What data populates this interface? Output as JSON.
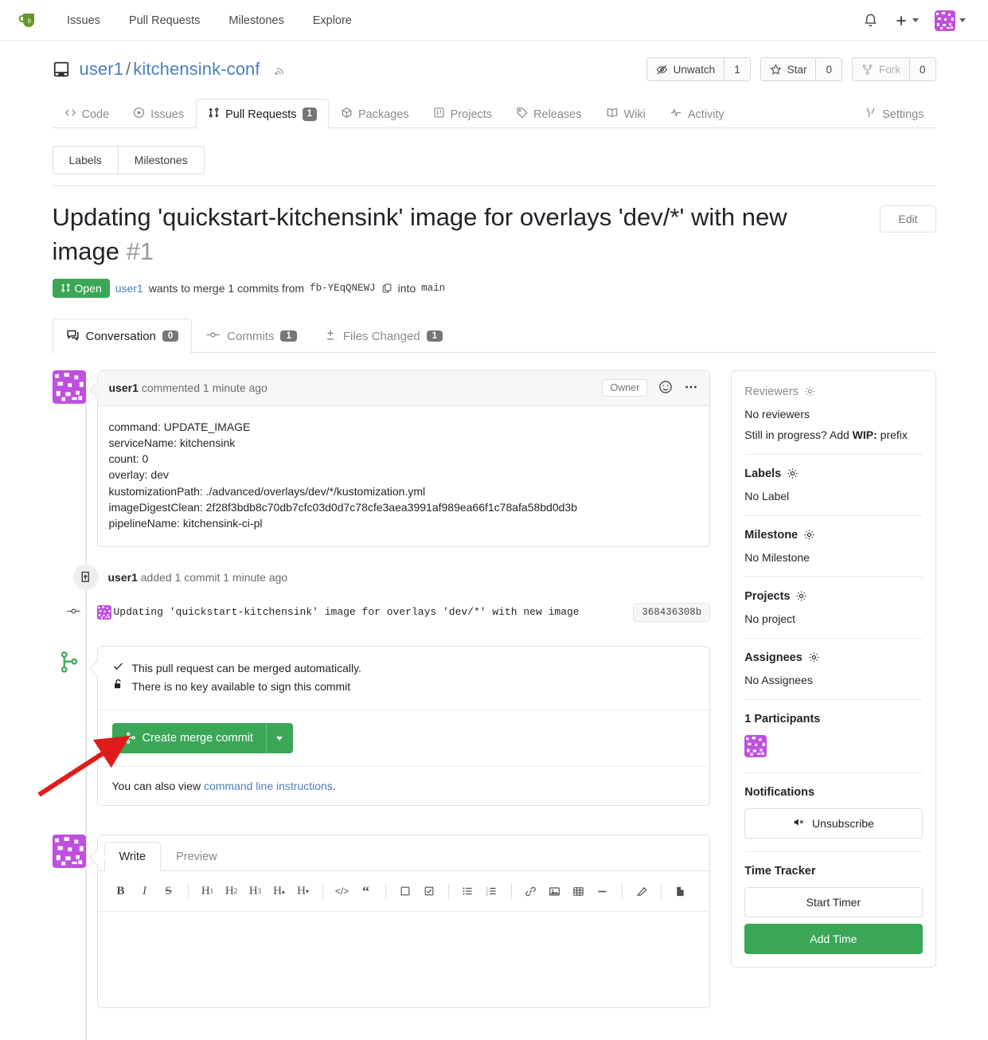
{
  "navbar": {
    "logo_icon": "gitea-logo-icon",
    "links": [
      "Issues",
      "Pull Requests",
      "Milestones",
      "Explore"
    ],
    "bell_icon": "bell-icon",
    "plus_icon": "plus-icon",
    "avatar_icon": "user-avatar"
  },
  "repo": {
    "icon": "repo-icon",
    "owner": "user1",
    "separator": "/",
    "name": "kitchensink-conf",
    "rss_icon": "rss-icon",
    "actions": [
      {
        "label": "Unwatch",
        "count": "1",
        "icon": "eye-slash-icon",
        "disabled": false
      },
      {
        "label": "Star",
        "count": "0",
        "icon": "star-icon",
        "disabled": false
      },
      {
        "label": "Fork",
        "count": "0",
        "icon": "fork-icon",
        "disabled": true
      }
    ],
    "tabs": [
      {
        "label": "Code",
        "icon": "code-icon",
        "count": null,
        "active": false
      },
      {
        "label": "Issues",
        "icon": "issue-opened-icon",
        "count": null,
        "active": false
      },
      {
        "label": "Pull Requests",
        "icon": "git-pull-request-icon",
        "count": "1",
        "active": true
      },
      {
        "label": "Packages",
        "icon": "package-icon",
        "count": null,
        "active": false
      },
      {
        "label": "Projects",
        "icon": "project-icon",
        "count": null,
        "active": false
      },
      {
        "label": "Releases",
        "icon": "tag-icon",
        "count": null,
        "active": false
      },
      {
        "label": "Wiki",
        "icon": "book-icon",
        "count": null,
        "active": false
      },
      {
        "label": "Activity",
        "icon": "pulse-icon",
        "count": null,
        "active": false
      }
    ],
    "settings_tab": {
      "label": "Settings",
      "icon": "tools-icon"
    }
  },
  "filters": {
    "labels": "Labels",
    "milestones": "Milestones"
  },
  "issue": {
    "title": "Updating 'quickstart-kitchensink' image for overlays 'dev/*' with new image",
    "number": "#1",
    "edit_label": "Edit",
    "status": "Open",
    "status_color": "#3aa757",
    "author": "user1",
    "meta_prefix": "wants to merge 1 commits from",
    "source_branch": "fb-YEqQNEWJ",
    "meta_into": "into",
    "target_branch": "main",
    "copy_icon": "copy-icon"
  },
  "pr_tabs": [
    {
      "label": "Conversation",
      "icon": "comment-icon",
      "count": "0",
      "active": true
    },
    {
      "label": "Commits",
      "icon": "git-commit-icon",
      "count": "1",
      "active": false
    },
    {
      "label": "Files Changed",
      "icon": "diff-icon",
      "count": "1",
      "active": false
    }
  ],
  "comment": {
    "author": "user1",
    "action": "commented",
    "time": "1 minute ago",
    "owner_tag": "Owner",
    "emoji_icon": "smiley-icon",
    "more_icon": "kebab-horizontal-icon",
    "body_lines": [
      "command: UPDATE_IMAGE",
      "serviceName: kitchensink",
      "count: 0",
      "overlay: dev",
      "kustomizationPath: ./advanced/overlays/dev/*/kustomization.yml",
      "imageDigestClean: 2f28f3bdb8c70db7cfc03d0d7c78cfe3aea3991af989ea66f1c78afa58bd0d3b",
      "pipelineName: kitchensink-ci-pl"
    ]
  },
  "commit_event": {
    "icon": "repo-push-icon",
    "author": "user1",
    "text": "added 1 commit",
    "time": "1 minute ago",
    "commit_message": "Updating 'quickstart-kitchensink' image for overlays 'dev/*' with new image",
    "commit_sha": "368436308b",
    "dot_icon": "git-commit-dot-icon"
  },
  "merge": {
    "branch_icon": "git-merge-icon",
    "status_lines": [
      {
        "icon": "check-icon",
        "text": "This pull request can be merged automatically."
      },
      {
        "icon": "unlock-icon",
        "text": "There is no key available to sign this commit"
      }
    ],
    "button_label": "Create merge commit",
    "button_icon": "git-merge-icon",
    "button_color": "#3aa757",
    "dropdown_icon": "chevron-down-icon",
    "cli_prefix": "You can also view",
    "cli_link": "command line instructions",
    "cli_suffix": "."
  },
  "annotation": {
    "arrow_color": "#e01b1b",
    "arrow_icon": "red-arrow-pointer"
  },
  "editor": {
    "tabs": [
      {
        "label": "Write",
        "active": true
      },
      {
        "label": "Preview",
        "active": false
      }
    ],
    "toolbar": [
      {
        "icon": "bold-icon",
        "glyph": "B",
        "style": "bold-serif"
      },
      {
        "icon": "italic-icon",
        "glyph": "I",
        "style": "italic-serif"
      },
      {
        "icon": "strikethrough-icon",
        "glyph": "S",
        "style": "strike-serif"
      },
      {
        "sep": true
      },
      {
        "icon": "heading-1-icon",
        "glyph": "H",
        "sub": "1"
      },
      {
        "icon": "heading-2-icon",
        "glyph": "H",
        "sub": "2"
      },
      {
        "icon": "heading-3-icon",
        "glyph": "H",
        "sub": "3"
      },
      {
        "icon": "heading-up-icon",
        "glyph": "H",
        "sub": "▴"
      },
      {
        "icon": "heading-down-icon",
        "glyph": "H",
        "sub": "▾"
      },
      {
        "sep": true
      },
      {
        "icon": "code-icon",
        "glyph": "</>"
      },
      {
        "icon": "quote-icon",
        "glyph": "“"
      },
      {
        "sep": true
      },
      {
        "icon": "unchecked-box-icon",
        "glyph": "□"
      },
      {
        "icon": "checked-box-icon",
        "glyph": "☑"
      },
      {
        "sep": true
      },
      {
        "icon": "bulleted-list-icon",
        "glyph": "☰"
      },
      {
        "icon": "numbered-list-icon",
        "glyph": "☰"
      },
      {
        "sep": true
      },
      {
        "icon": "link-icon",
        "glyph": "⚭"
      },
      {
        "icon": "image-icon",
        "glyph": "Ὓb"
      },
      {
        "icon": "table-icon",
        "glyph": "▦"
      },
      {
        "icon": "horizontal-rule-icon",
        "glyph": "—"
      },
      {
        "sep": true
      },
      {
        "icon": "eraser-icon",
        "glyph": "▱"
      },
      {
        "sep": true
      },
      {
        "icon": "file-icon",
        "glyph": "὜e"
      }
    ],
    "placeholder": ""
  },
  "sidebar": {
    "sections": [
      {
        "title": "Reviewers",
        "title_style": "muted",
        "gear": "gear-icon",
        "lines": [
          {
            "text": "No reviewers",
            "bold_part": null
          },
          {
            "text": "Still in progress? Add ",
            "bold_part": "WIP:",
            "suffix": " prefix"
          }
        ]
      },
      {
        "title": "Labels",
        "title_style": "bold",
        "gear": "gear-icon",
        "lines": [
          {
            "text": "No Label",
            "bold_part": null
          }
        ]
      },
      {
        "title": "Milestone",
        "title_style": "bold",
        "gear": "gear-icon",
        "lines": [
          {
            "text": "No Milestone",
            "bold_part": null
          }
        ]
      },
      {
        "title": "Projects",
        "title_style": "bold",
        "gear": "gear-icon",
        "lines": [
          {
            "text": "No project",
            "bold_part": null
          }
        ]
      },
      {
        "title": "Assignees",
        "title_style": "bold",
        "gear": "gear-icon",
        "lines": [
          {
            "text": "No Assignees",
            "bold_part": null
          }
        ]
      }
    ],
    "participants": {
      "title": "1 Participants",
      "avatar_icon": "participant-avatar"
    },
    "notifications": {
      "title": "Notifications",
      "button_label": "Unsubscribe",
      "button_icon": "mute-icon"
    },
    "time_tracker": {
      "title": "Time Tracker",
      "start_label": "Start Timer",
      "add_label": "Add Time",
      "add_color": "#3aa757"
    }
  }
}
